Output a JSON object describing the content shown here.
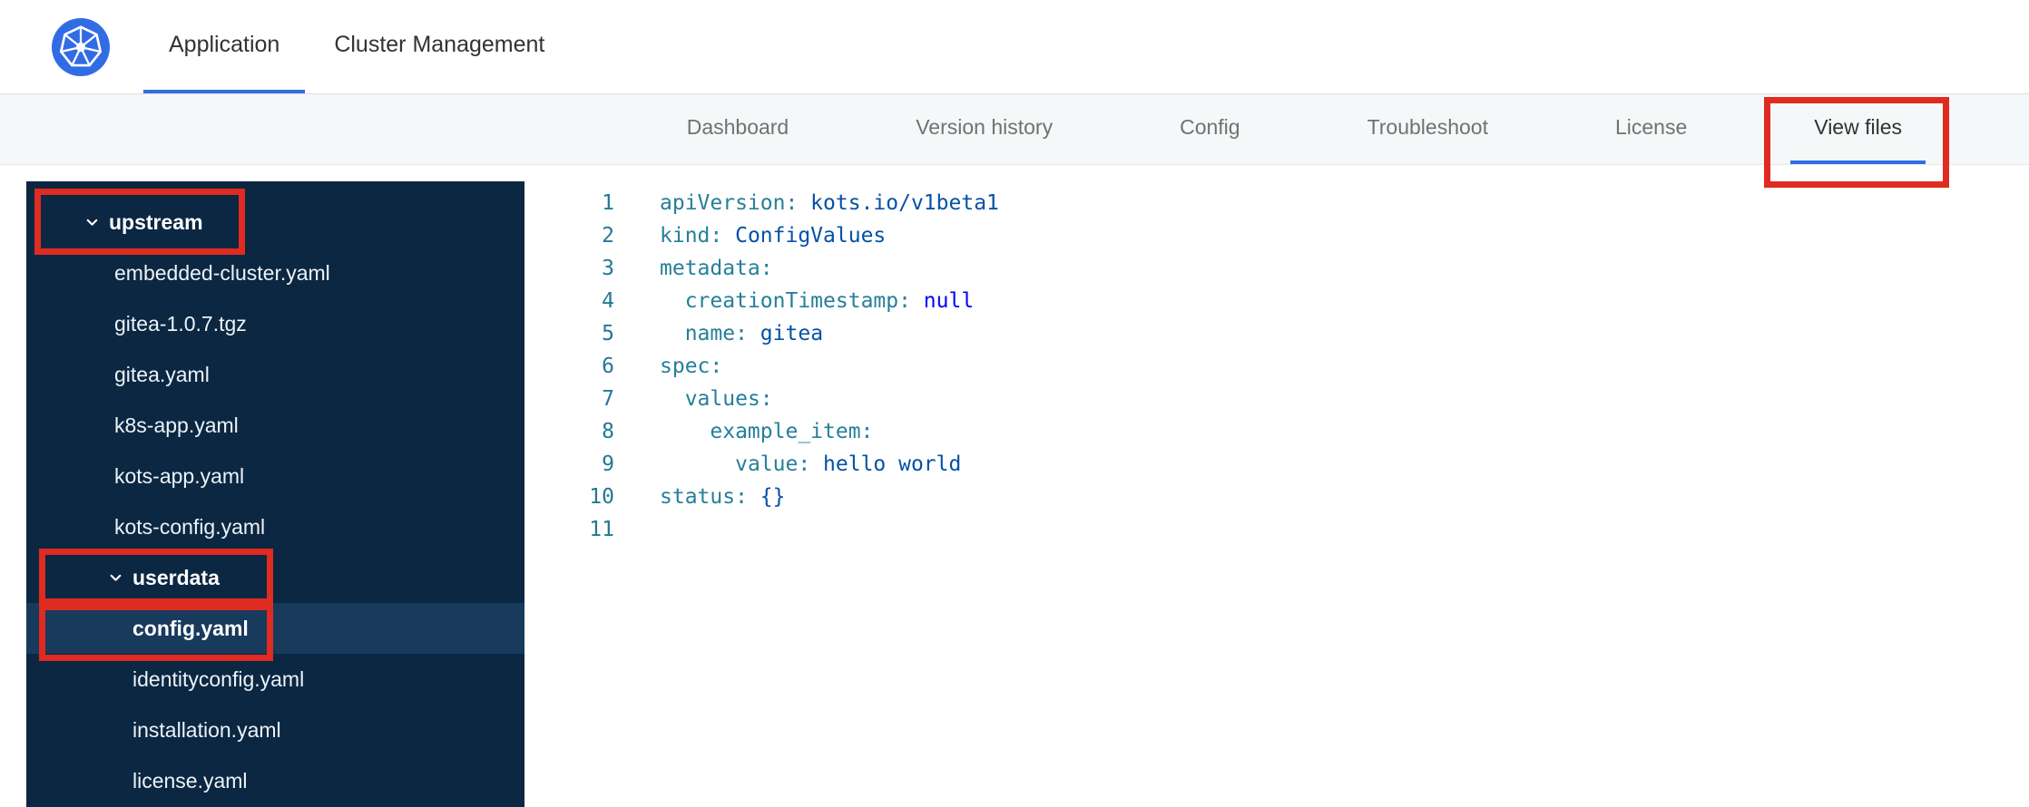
{
  "topbar": {
    "tabs": [
      {
        "label": "Application",
        "active": true
      },
      {
        "label": "Cluster Management",
        "active": false
      }
    ]
  },
  "subnav": {
    "items": [
      {
        "label": "Dashboard",
        "active": false
      },
      {
        "label": "Version history",
        "active": false
      },
      {
        "label": "Config",
        "active": false
      },
      {
        "label": "Troubleshoot",
        "active": false
      },
      {
        "label": "License",
        "active": false
      },
      {
        "label": "View files",
        "active": true,
        "annotated": true
      }
    ]
  },
  "file_tree": [
    {
      "kind": "folder",
      "label": "upstream",
      "indent": 0,
      "expanded": true,
      "annotated": true
    },
    {
      "kind": "file",
      "label": "embedded-cluster.yaml",
      "indent": 1
    },
    {
      "kind": "file",
      "label": "gitea-1.0.7.tgz",
      "indent": 1
    },
    {
      "kind": "file",
      "label": "gitea.yaml",
      "indent": 1
    },
    {
      "kind": "file",
      "label": "k8s-app.yaml",
      "indent": 1
    },
    {
      "kind": "file",
      "label": "kots-app.yaml",
      "indent": 1
    },
    {
      "kind": "file",
      "label": "kots-config.yaml",
      "indent": 1
    },
    {
      "kind": "folder",
      "label": "userdata",
      "indent": 1,
      "expanded": true,
      "annotated": true
    },
    {
      "kind": "file",
      "label": "config.yaml",
      "indent": 2,
      "selected": true,
      "annotated": true
    },
    {
      "kind": "file",
      "label": "identityconfig.yaml",
      "indent": 2
    },
    {
      "kind": "file",
      "label": "installation.yaml",
      "indent": 2
    },
    {
      "kind": "file",
      "label": "license.yaml",
      "indent": 2
    }
  ],
  "editor": {
    "lines": [
      {
        "num": 1,
        "tokens": [
          [
            "key",
            "apiVersion:"
          ],
          [
            "val",
            " kots.io/v1beta1"
          ]
        ]
      },
      {
        "num": 2,
        "tokens": [
          [
            "key",
            "kind:"
          ],
          [
            "val",
            " ConfigValues"
          ]
        ]
      },
      {
        "num": 3,
        "tokens": [
          [
            "key",
            "metadata:"
          ]
        ]
      },
      {
        "num": 4,
        "tokens": [
          [
            "plain",
            "  "
          ],
          [
            "key",
            "creationTimestamp:"
          ],
          [
            "kw",
            " null"
          ]
        ]
      },
      {
        "num": 5,
        "tokens": [
          [
            "plain",
            "  "
          ],
          [
            "key",
            "name:"
          ],
          [
            "val",
            " gitea"
          ]
        ]
      },
      {
        "num": 6,
        "tokens": [
          [
            "key",
            "spec:"
          ]
        ]
      },
      {
        "num": 7,
        "tokens": [
          [
            "plain",
            "  "
          ],
          [
            "key",
            "values:"
          ]
        ]
      },
      {
        "num": 8,
        "tokens": [
          [
            "plain",
            "    "
          ],
          [
            "key",
            "example_item:"
          ]
        ]
      },
      {
        "num": 9,
        "tokens": [
          [
            "plain",
            "      "
          ],
          [
            "key",
            "value:"
          ],
          [
            "val",
            " hello world"
          ]
        ]
      },
      {
        "num": 10,
        "tokens": [
          [
            "key",
            "status:"
          ],
          [
            "val",
            " {}"
          ]
        ]
      },
      {
        "num": 11,
        "tokens": []
      }
    ]
  },
  "colors": {
    "accent_blue": "#326de6",
    "logo_blue": "#326ce5",
    "sidebar_bg": "#0b2742",
    "sidebar_selected_bg": "#173a5d",
    "annotation_red": "#e02b20",
    "code_key": "#267f99",
    "code_value": "#0451a5",
    "code_keyword": "#0000ff",
    "line_number": "#237893"
  }
}
